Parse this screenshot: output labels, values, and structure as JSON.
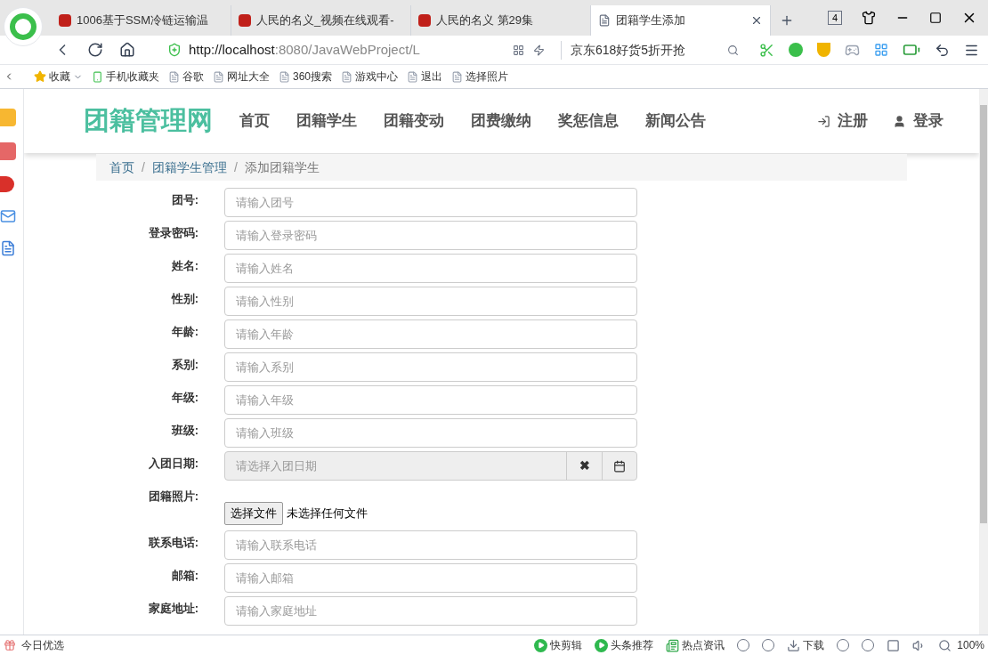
{
  "browser": {
    "tabs": [
      {
        "title": "1006基于SSM冷链运输温",
        "selected": false
      },
      {
        "title": "人民的名义_视频在线观看-",
        "selected": false
      },
      {
        "title": "人民的名义 第29集",
        "selected": false
      },
      {
        "title": "团籍学生添加",
        "selected": true
      }
    ],
    "tab_count": "4",
    "url_host": "http://localhost",
    "url_rest": ":8080/JavaWebProject/L",
    "search_hint": "京东618好货5折开抢",
    "bookmarks": [
      "收藏",
      "手机收藏夹",
      "谷歌",
      "网址大全",
      "360搜索",
      "游戏中心",
      "退出",
      "选择照片"
    ]
  },
  "site": {
    "logo": "团籍管理网",
    "nav": [
      "首页",
      "团籍学生",
      "团籍变动",
      "团费缴纳",
      "奖惩信息",
      "新闻公告"
    ],
    "auth": [
      {
        "kind": "register",
        "label": "注册"
      },
      {
        "kind": "login",
        "label": "登录"
      }
    ],
    "breadcrumb_separator": "/",
    "breadcrumb": [
      {
        "label": "首页",
        "kind": "link"
      },
      {
        "label": "团籍学生管理",
        "kind": "link"
      },
      {
        "label": "添加团籍学生",
        "kind": "current"
      }
    ],
    "form": [
      {
        "label": "团号:",
        "kind": "text",
        "placeholder": "请输入团号"
      },
      {
        "label": "登录密码:",
        "kind": "text",
        "placeholder": "请输入登录密码"
      },
      {
        "label": "姓名:",
        "kind": "text",
        "placeholder": "请输入姓名"
      },
      {
        "label": "性别:",
        "kind": "text",
        "placeholder": "请输入性别"
      },
      {
        "label": "年龄:",
        "kind": "text",
        "placeholder": "请输入年龄"
      },
      {
        "label": "系别:",
        "kind": "text",
        "placeholder": "请输入系别"
      },
      {
        "label": "年级:",
        "kind": "text",
        "placeholder": "请输入年级"
      },
      {
        "label": "班级:",
        "kind": "text",
        "placeholder": "请输入班级"
      },
      {
        "label": "入团日期:",
        "kind": "date",
        "placeholder": "请选择入团日期",
        "clear": "✖"
      },
      {
        "label": "团籍照片:",
        "kind": "file",
        "button": "选择文件",
        "status": "未选择任何文件"
      },
      {
        "label": "联系电话:",
        "kind": "text",
        "placeholder": "请输入联系电话"
      },
      {
        "label": "邮箱:",
        "kind": "text",
        "placeholder": "请输入邮箱"
      },
      {
        "label": "家庭地址:",
        "kind": "text",
        "placeholder": "请输入家庭地址"
      }
    ]
  },
  "status_bar": {
    "left": "今日优选",
    "items": [
      {
        "kind": "play",
        "label": "快剪辑"
      },
      {
        "kind": "play",
        "label": "头条推荐"
      },
      {
        "kind": "news",
        "label": "热点资讯"
      },
      {
        "kind": "circle"
      },
      {
        "kind": "circle"
      },
      {
        "kind": "download",
        "label": "下载"
      },
      {
        "kind": "circle"
      },
      {
        "kind": "circle"
      },
      {
        "kind": "square"
      },
      {
        "kind": "speaker"
      },
      {
        "kind": "search"
      }
    ],
    "zoom": "100%"
  }
}
